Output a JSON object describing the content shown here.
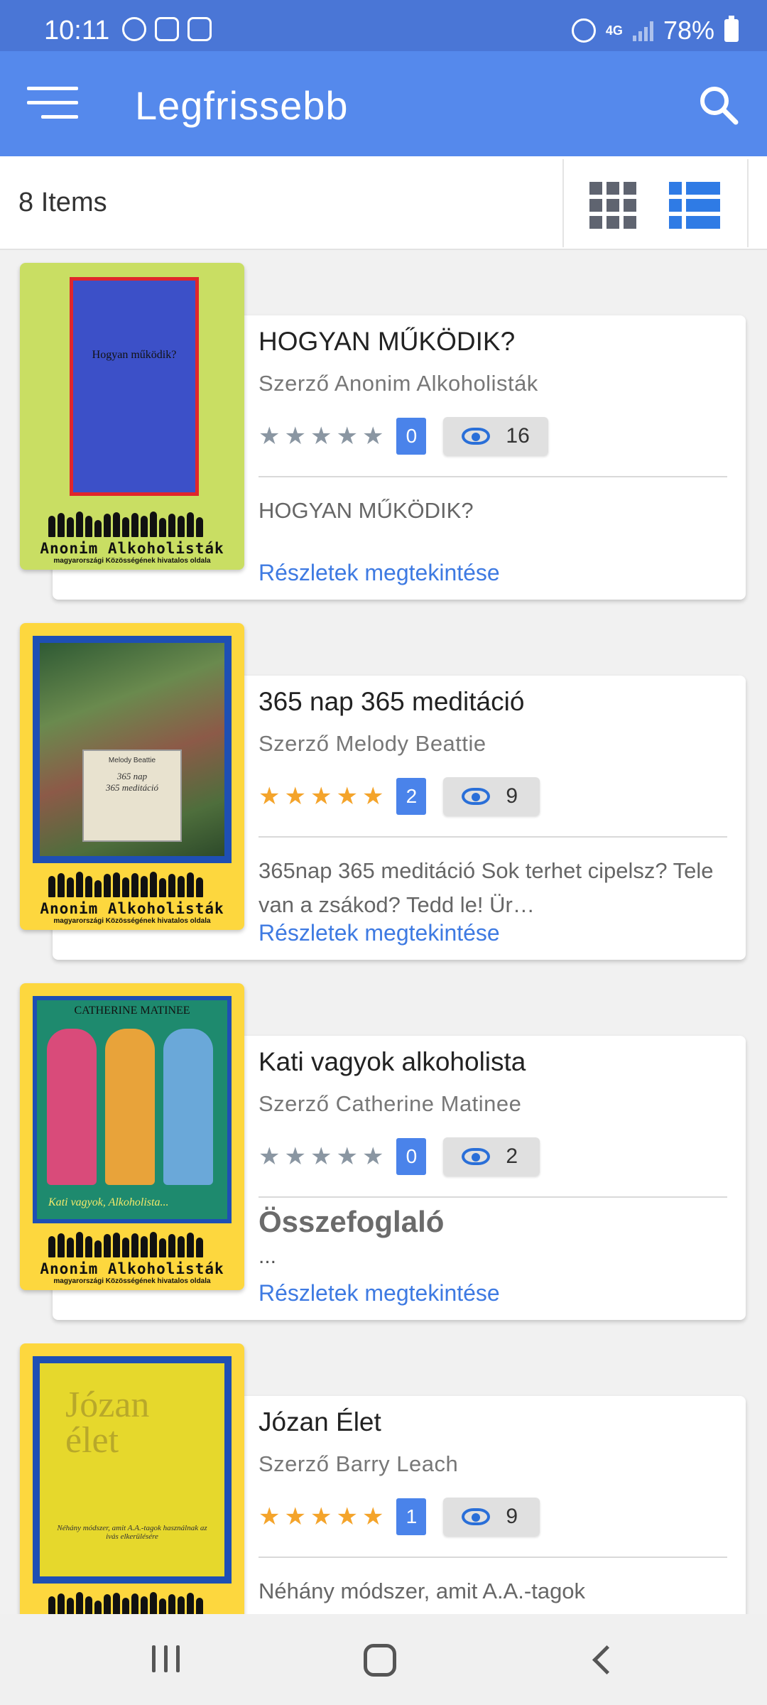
{
  "status_bar": {
    "time": "10:11",
    "network": "4G",
    "battery": "78%"
  },
  "app_bar": {
    "title": "Legfrissebb"
  },
  "toolbar": {
    "items_count": "8 Items"
  },
  "books": [
    {
      "title": "HOGYAN MŰKÖDIK?",
      "author": "Szerző Anonim Alkoholisták",
      "rating_stars": 0,
      "votes": "0",
      "views": "16",
      "description": "HOGYAN MŰKÖDIK?",
      "link": "Részletek megtekintése",
      "cover": {
        "title": "Hogyan működik?",
        "footer": "Anonim Alkoholisták",
        "subfooter": "magyarországi Közösségének hivatalos oldala",
        "bg": "#c9de63",
        "inner": "#3c50c8",
        "border": "#e0262b"
      }
    },
    {
      "title": "365 nap 365 meditáció",
      "author": "Szerző Melody Beattie",
      "rating_stars": 5,
      "votes": "2",
      "views": "9",
      "description": "365nap 365 meditáció Sok terhet cipelsz? Tele van a zsákod? Tedd le! Ür…",
      "link": "Részletek megtekintése",
      "cover": {
        "title": "365 nap\n365 meditáció",
        "author": "Melody Beattie",
        "footer": "Anonim Alkoholisták",
        "subfooter": "magyarországi Közösségének hivatalos oldala",
        "bg": "#fdd73e",
        "inner": "#5a6e48",
        "border": "#1e4fb4"
      }
    },
    {
      "title": "Kati vagyok alkoholista",
      "author": "Szerző Catherine Matinee",
      "rating_stars": 0,
      "votes": "0",
      "views": "2",
      "summary_heading": "Összefoglaló",
      "description": "...",
      "link": "Részletek megtekintése",
      "cover": {
        "title": "CATHERINE MATINEE",
        "subtitle": "Kati vagyok, Alkoholista...",
        "footer": "Anonim Alkoholisták",
        "subfooter": "magyarországi Közösségének hivatalos oldala",
        "bg": "#fdd73e",
        "inner": "#1e8a6e",
        "border": "#1e4fb4"
      }
    },
    {
      "title": "Józan Élet",
      "author": "Szerző Barry Leach",
      "rating_stars": 5,
      "votes": "1",
      "views": "9",
      "description": "Néhány módszer, amit A.A.-tagok",
      "cover": {
        "title": "Józan\nélet",
        "subtitle": "Néhány módszer, amit A.A.-tagok használnak az ivás elkerülésére",
        "bg": "#fdd73e",
        "inner": "#e6d82c",
        "border": "#1e4fb4"
      }
    }
  ]
}
